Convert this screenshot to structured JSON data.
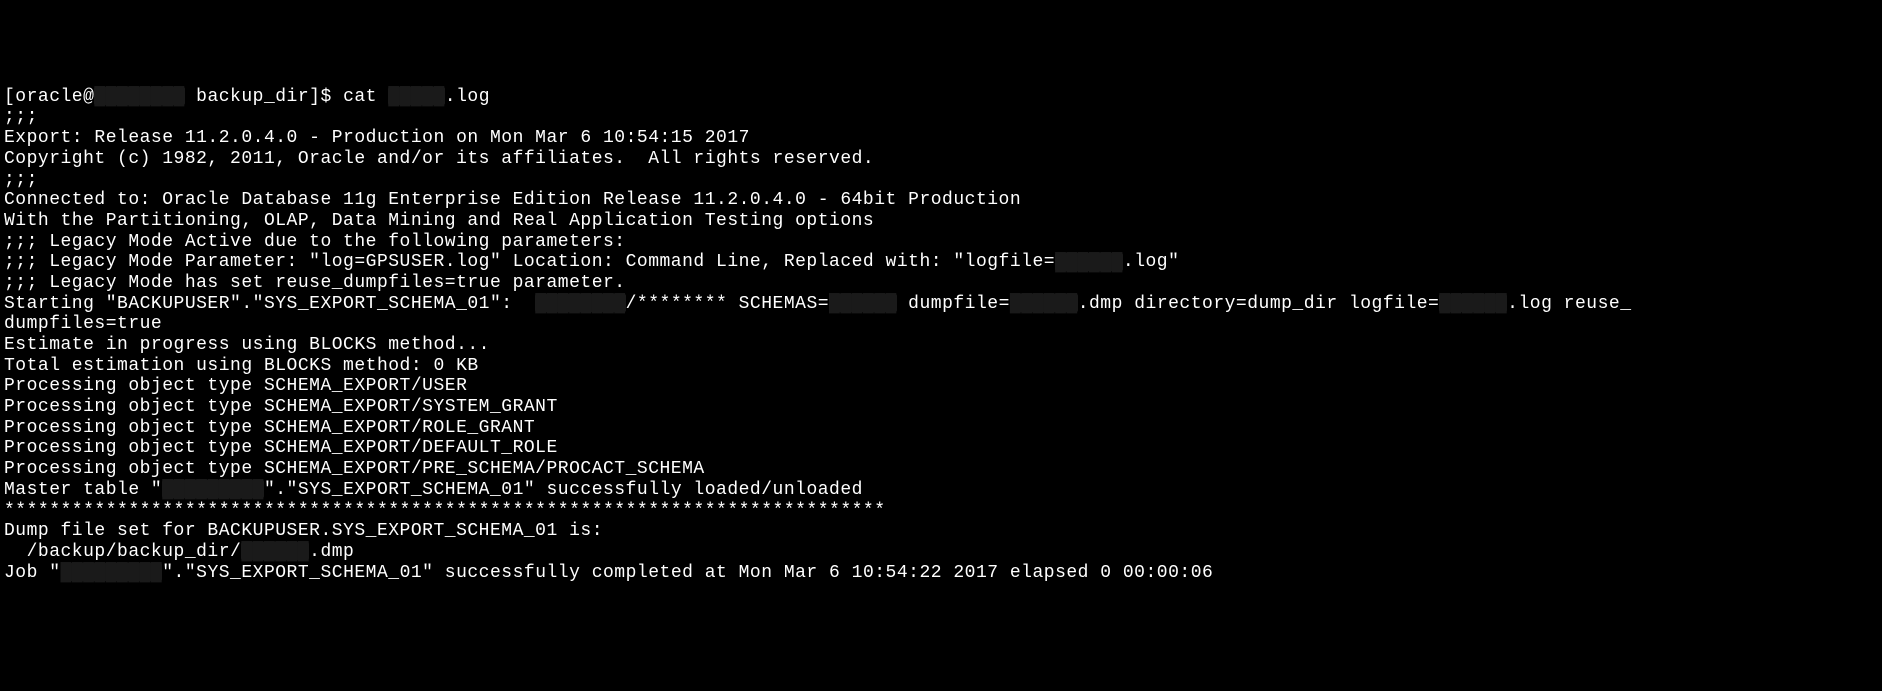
{
  "terminal": {
    "prompt_prefix": "[oracle@",
    "prompt_host_redacted": "████████",
    "prompt_suffix": " backup_dir]$ cat ",
    "prompt_file_redacted": "█████",
    "prompt_ext": ".log",
    "lines": {
      "semi1": ";;;",
      "export": "Export: Release 11.2.0.4.0 - Production on Mon Mar 6 10:54:15 2017",
      "blank1": "",
      "copyright": "Copyright (c) 1982, 2011, Oracle and/or its affiliates.  All rights reserved.",
      "semi2": ";;;",
      "connected": "Connected to: Oracle Database 11g Enterprise Edition Release 11.2.0.4.0 - 64bit Production",
      "options": "With the Partitioning, OLAP, Data Mining and Real Application Testing options",
      "legacy1": ";;; Legacy Mode Active due to the following parameters:",
      "legacy2_a": ";;; Legacy Mode Parameter: \"log=GPSUSER.log\" Location: Command Line, Replaced with: \"logfile=",
      "legacy2_redacted": "██████",
      "legacy2_b": ".log\"",
      "legacy3": ";;; Legacy Mode has set reuse_dumpfiles=true parameter.",
      "starting_a": "Starting \"BACKUPUSER\".\"SYS_EXPORT_SCHEMA_01\":  ",
      "starting_r1": "████████",
      "starting_b": "/******** SCHEMAS=",
      "starting_r2": "██████",
      "starting_c": " dumpfile=",
      "starting_r3": "██████",
      "starting_d": ".dmp directory=dump_dir logfile=",
      "starting_r4": "██████",
      "starting_e": ".log reuse_",
      "starting_wrap": "dumpfiles=true",
      "estimate": "Estimate in progress using BLOCKS method...",
      "total": "Total estimation using BLOCKS method: 0 KB",
      "proc1": "Processing object type SCHEMA_EXPORT/USER",
      "proc2": "Processing object type SCHEMA_EXPORT/SYSTEM_GRANT",
      "proc3": "Processing object type SCHEMA_EXPORT/ROLE_GRANT",
      "proc4": "Processing object type SCHEMA_EXPORT/DEFAULT_ROLE",
      "proc5": "Processing object type SCHEMA_EXPORT/PRE_SCHEMA/PROCACT_SCHEMA",
      "master_a": "Master table \"",
      "master_r": "█████████",
      "master_b": "\".\"SYS_EXPORT_SCHEMA_01\" successfully loaded/unloaded",
      "stars": "******************************************************************************",
      "dumpset": "Dump file set for BACKUPUSER.SYS_EXPORT_SCHEMA_01 is:",
      "dumppath_a": "  /backup/backup_dir/",
      "dumppath_r": "██████",
      "dumppath_b": ".dmp",
      "job_a": "Job \"",
      "job_r": "█████████",
      "job_b": "\".\"SYS_EXPORT_SCHEMA_01\" successfully completed at Mon Mar 6 10:54:22 2017 elapsed 0 00:00:06"
    }
  }
}
